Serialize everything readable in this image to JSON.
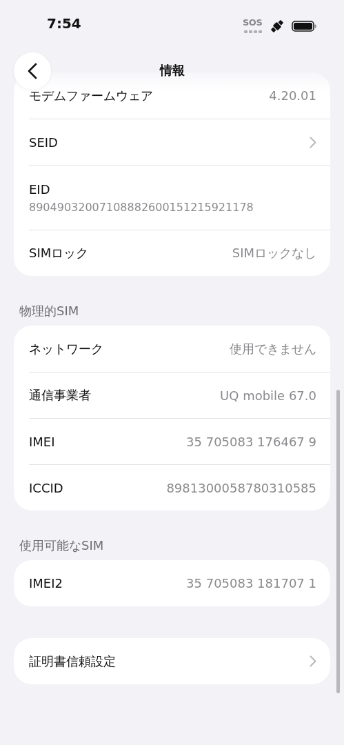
{
  "status_bar": {
    "time": "7:54",
    "sos": "SOS"
  },
  "nav": {
    "title": "情報"
  },
  "sections": [
    {
      "rows": [
        {
          "kind": "value",
          "label": "モデムファームウェア",
          "value": "4.20.01"
        },
        {
          "kind": "chevron",
          "label": "SEID"
        },
        {
          "kind": "stacked",
          "label": "EID",
          "value": "89049032007108882600151215921178"
        },
        {
          "kind": "value",
          "label": "SIMロック",
          "value": "SIMロックなし"
        }
      ]
    },
    {
      "header": "物理的SIM",
      "rows": [
        {
          "kind": "value",
          "label": "ネットワーク",
          "value": "使用できません"
        },
        {
          "kind": "value",
          "label": "通信事業者",
          "value": "UQ mobile 67.0"
        },
        {
          "kind": "value",
          "label": "IMEI",
          "value": "35 705083 176467 9"
        },
        {
          "kind": "value",
          "label": "ICCID",
          "value": "8981300058780310585"
        }
      ]
    },
    {
      "header": "使用可能なSIM",
      "rows": [
        {
          "kind": "value",
          "label": "IMEI2",
          "value": "35 705083 181707 1"
        }
      ]
    },
    {
      "rows": [
        {
          "kind": "chevron",
          "label": "証明書信頼設定"
        }
      ]
    }
  ]
}
